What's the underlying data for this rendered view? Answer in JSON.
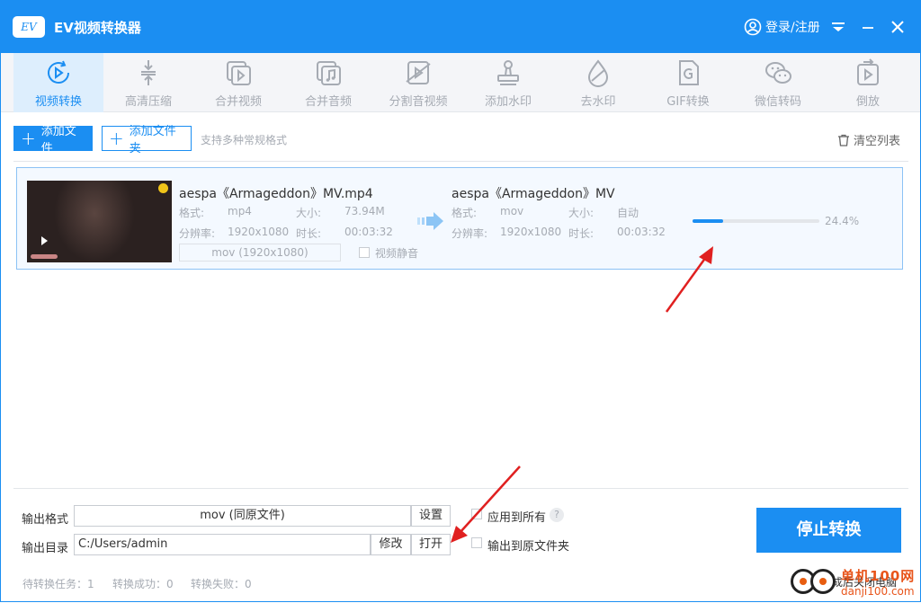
{
  "app": {
    "logo_text": "EV",
    "title": "EV视频转换器",
    "login": "登录/注册"
  },
  "toolbar": [
    {
      "label": "视频转换",
      "icon": "video-convert-icon"
    },
    {
      "label": "高清压缩",
      "icon": "compress-icon"
    },
    {
      "label": "合并视频",
      "icon": "merge-video-icon"
    },
    {
      "label": "合并音频",
      "icon": "merge-audio-icon"
    },
    {
      "label": "分割音视频",
      "icon": "split-icon"
    },
    {
      "label": "添加水印",
      "icon": "stamp-icon"
    },
    {
      "label": "去水印",
      "icon": "drop-icon"
    },
    {
      "label": "GIF转换",
      "icon": "gif-icon"
    },
    {
      "label": "微信转码",
      "icon": "wechat-icon"
    },
    {
      "label": "倒放",
      "icon": "reverse-icon"
    }
  ],
  "actions": {
    "add_file": "添加文件",
    "add_folder": "添加文件夹",
    "hint": "支持多种常规格式",
    "clear": "清空列表"
  },
  "file": {
    "source_name": "aespa《Armageddon》MV.mp4",
    "format_label": "格式:",
    "format": "mp4",
    "size_label": "大小:",
    "size": "73.94M",
    "resolution_label": "分辨率:",
    "resolution": "1920x1080",
    "duration_label": "时长:",
    "duration": "00:03:32",
    "output_format_box": "mov (1920x1080)",
    "mute_label": "视频静音",
    "target_name": "aespa《Armageddon》MV",
    "target_format": "mov",
    "target_size": "自动",
    "target_resolution": "1920x1080",
    "target_duration": "00:03:32",
    "progress": 0.244,
    "progress_text": "24.4%"
  },
  "bottom": {
    "format_label": "输出格式",
    "format_value": "mov (同原文件)",
    "settings": "设置",
    "apply_all": "应用到所有",
    "help": "?",
    "dir_label": "输出目录",
    "dir_value": "C:/Users/admin",
    "modify": "修改",
    "open": "打开",
    "output_to_source": "输出到原文件夹",
    "stop": "停止转换",
    "pending": "待转换任务：1",
    "success": "转换成功：0",
    "failed": "转换失败：0",
    "after": "转换完成后关闭电脑"
  },
  "watermark": {
    "cn": "单机100网",
    "en": "danji100.com"
  },
  "colors": {
    "accent": "#1b8ef2",
    "annotation": "#e02020"
  }
}
